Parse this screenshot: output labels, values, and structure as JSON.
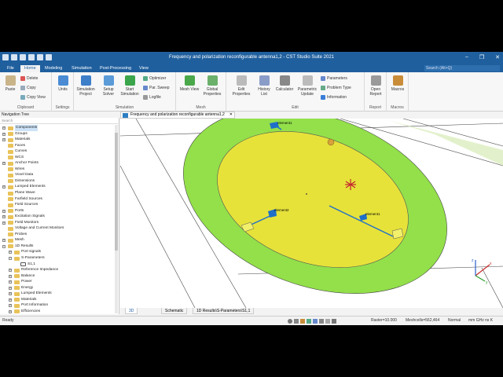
{
  "titlebar": {
    "title": "Frequency and polarization reconfigurable antenna1,2 - CST Studio Suite 2021"
  },
  "menu": {
    "tabs": [
      "File",
      "Home",
      "Modeling",
      "Simulation",
      "Post-Processing",
      "View"
    ],
    "active": "Home",
    "search_placeholder": "Search (Alt+Q)"
  },
  "ribbon": {
    "clipboard": {
      "label": "Clipboard",
      "paste": "Paste",
      "delete": "Delete",
      "copy": "Copy",
      "copy_view": "Copy View"
    },
    "settings": {
      "label": "Settings",
      "units": "Units"
    },
    "simulation": {
      "label": "Simulation",
      "sim_project": "Simulation Project",
      "setup_solver": "Setup Solver",
      "start_simulation": "Start Simulation",
      "optimizer": "Optimizer",
      "par_sweep": "Par. Sweep",
      "logfile": "Logfile"
    },
    "mesh": {
      "label": "Mesh",
      "mesh_view": "Mesh View",
      "global_properties": "Global Properties"
    },
    "edit": {
      "label": "Edit",
      "edit_properties": "Edit Properties",
      "history_list": "History List",
      "calculator": "Calculator",
      "parametric_update": "Parametric Update",
      "parameters": "Parameters",
      "problem_type": "Problem Type",
      "information": "Information"
    },
    "report": {
      "label": "Report",
      "open_report": "Open Report"
    },
    "macros": {
      "label": "Macros",
      "macros": "Macros"
    }
  },
  "nav": {
    "title": "Navigation Tree",
    "search_placeholder": "Search",
    "items": [
      {
        "label": "Components",
        "level": 0,
        "expander": "+"
      },
      {
        "label": "Groups",
        "level": 0,
        "expander": "+"
      },
      {
        "label": "Materials",
        "level": 0,
        "expander": "+"
      },
      {
        "label": "Faces",
        "level": 0,
        "expander": ""
      },
      {
        "label": "Curves",
        "level": 0,
        "expander": ""
      },
      {
        "label": "WCS",
        "level": 0,
        "expander": ""
      },
      {
        "label": "Anchor Points",
        "level": 0,
        "expander": "+"
      },
      {
        "label": "Wires",
        "level": 0,
        "expander": ""
      },
      {
        "label": "Voxel Data",
        "level": 0,
        "expander": ""
      },
      {
        "label": "Dimensions",
        "level": 0,
        "expander": ""
      },
      {
        "label": "Lumped Elements",
        "level": 0,
        "expander": "+"
      },
      {
        "label": "Plane Wave",
        "level": 0,
        "expander": ""
      },
      {
        "label": "Farfield Sources",
        "level": 0,
        "expander": ""
      },
      {
        "label": "Field Sources",
        "level": 0,
        "expander": ""
      },
      {
        "label": "Ports",
        "level": 0,
        "expander": "+"
      },
      {
        "label": "Excitation Signals",
        "level": 0,
        "expander": "+"
      },
      {
        "label": "Field Monitors",
        "level": 0,
        "expander": "+"
      },
      {
        "label": "Voltage and Current Monitors",
        "level": 0,
        "expander": ""
      },
      {
        "label": "Probes",
        "level": 0,
        "expander": ""
      },
      {
        "label": "Mesh",
        "level": 0,
        "expander": "+"
      },
      {
        "label": "1D Results",
        "level": 0,
        "expander": "−"
      },
      {
        "label": "Port signals",
        "level": 1,
        "expander": "+"
      },
      {
        "label": "S-Parameters",
        "level": 1,
        "expander": "−"
      },
      {
        "label": "S1,1",
        "level": 2,
        "expander": ""
      },
      {
        "label": "Reference Impedance",
        "level": 1,
        "expander": "+"
      },
      {
        "label": "Balance",
        "level": 1,
        "expander": "+"
      },
      {
        "label": "Power",
        "level": 1,
        "expander": "+"
      },
      {
        "label": "Energy",
        "level": 1,
        "expander": "+"
      },
      {
        "label": "Lumped Elements",
        "level": 1,
        "expander": "+"
      },
      {
        "label": "Materials",
        "level": 1,
        "expander": "+"
      },
      {
        "label": "Port Information",
        "level": 1,
        "expander": "+"
      },
      {
        "label": "Efficiencies",
        "level": 1,
        "expander": "+"
      }
    ]
  },
  "doc_tab": {
    "label": "Frequency and polarization reconfigurable antenna1,2"
  },
  "viewport": {
    "labels": [
      "element1",
      "element2",
      "element1"
    ]
  },
  "bottom_tabs": [
    "3D",
    "Schematic",
    "1D Results\\S-Parameters\\S1,1"
  ],
  "status": {
    "ready": "Ready",
    "raster": "Raster=10.000",
    "meshcells": "Meshcells=562,464",
    "mode": "Normal",
    "units": "mm  GHz  ns  K"
  },
  "colors": {
    "titlebar": "#1f5f9e",
    "patch": "#e6e23a",
    "substrate": "#93e04a",
    "feed": "#1f6fc9"
  }
}
